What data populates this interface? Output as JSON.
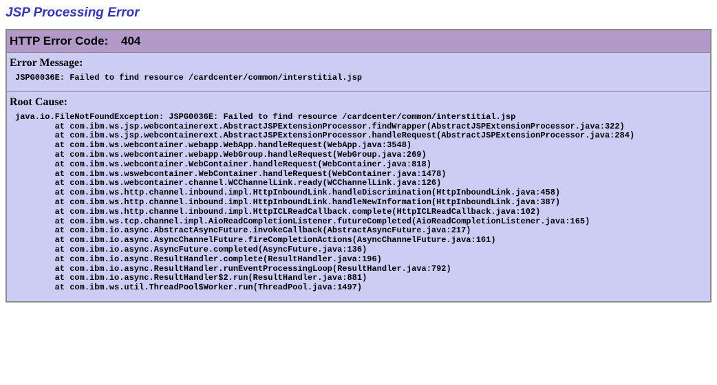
{
  "title": "JSP Processing Error",
  "header": {
    "label": "HTTP Error Code:",
    "code": "404"
  },
  "error_message": {
    "heading": "Error Message:",
    "text": "JSPG0036E: Failed to find resource /cardcenter/common/interstitial.jsp"
  },
  "root_cause": {
    "heading": "Root Cause:",
    "text": "java.io.FileNotFoundException: JSPG0036E: Failed to find resource /cardcenter/common/interstitial.jsp\n        at com.ibm.ws.jsp.webcontainerext.AbstractJSPExtensionProcessor.findWrapper(AbstractJSPExtensionProcessor.java:322)\n        at com.ibm.ws.jsp.webcontainerext.AbstractJSPExtensionProcessor.handleRequest(AbstractJSPExtensionProcessor.java:284)\n        at com.ibm.ws.webcontainer.webapp.WebApp.handleRequest(WebApp.java:3548)\n        at com.ibm.ws.webcontainer.webapp.WebGroup.handleRequest(WebGroup.java:269)\n        at com.ibm.ws.webcontainer.WebContainer.handleRequest(WebContainer.java:818)\n        at com.ibm.ws.wswebcontainer.WebContainer.handleRequest(WebContainer.java:1478)\n        at com.ibm.ws.webcontainer.channel.WCChannelLink.ready(WCChannelLink.java:126)\n        at com.ibm.ws.http.channel.inbound.impl.HttpInboundLink.handleDiscrimination(HttpInboundLink.java:458)\n        at com.ibm.ws.http.channel.inbound.impl.HttpInboundLink.handleNewInformation(HttpInboundLink.java:387)\n        at com.ibm.ws.http.channel.inbound.impl.HttpICLReadCallback.complete(HttpICLReadCallback.java:102)\n        at com.ibm.ws.tcp.channel.impl.AioReadCompletionListener.futureCompleted(AioReadCompletionListener.java:165)\n        at com.ibm.io.async.AbstractAsyncFuture.invokeCallback(AbstractAsyncFuture.java:217)\n        at com.ibm.io.async.AsyncChannelFuture.fireCompletionActions(AsyncChannelFuture.java:161)\n        at com.ibm.io.async.AsyncFuture.completed(AsyncFuture.java:136)\n        at com.ibm.io.async.ResultHandler.complete(ResultHandler.java:196)\n        at com.ibm.io.async.ResultHandler.runEventProcessingLoop(ResultHandler.java:792)\n        at com.ibm.io.async.ResultHandler$2.run(ResultHandler.java:881)\n        at com.ibm.ws.util.ThreadPool$Worker.run(ThreadPool.java:1497)"
  }
}
